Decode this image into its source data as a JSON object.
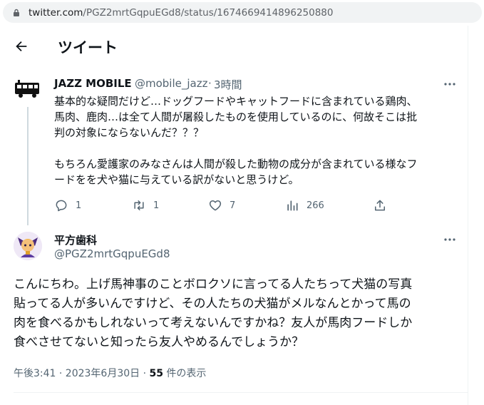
{
  "browser": {
    "url_domain": "twitter.com",
    "url_path": "/PGZ2mrtGqpuEGd8/status/1674669414896250880"
  },
  "header": {
    "title": "ツイート"
  },
  "parent_tweet": {
    "display_name": "JAZZ MOBILE",
    "handle": "@mobile_jazz",
    "separator": "·",
    "time": "3時間",
    "lines": [
      "基本的な疑問だけど…ドッグフードやキャットフードに含まれている鶏肉、",
      "馬肉、鹿肉…は全て人間が屠殺したものを使用しているのに、何故そこは批",
      "判の対象にならないんだ？？？",
      "",
      "もちろん愛護家のみなさんは人間が殺した動物の成分が含まれている様なフ",
      "ードをを犬や猫に与えている訳がないと思うけど。"
    ],
    "replies": "1",
    "retweets": "1",
    "likes": "7",
    "views": "266"
  },
  "main_tweet": {
    "display_name": "平方歯科",
    "handle": "@PGZ2mrtGqpuEGd8",
    "lines": [
      "こんにちわ。上げ馬神事のことボロクソに言ってる人たちって犬猫の写真",
      "貼ってる人が多いんですけど、その人たちの犬猫がメルなんとかって馬の",
      "肉を食べるかもしれないって考えないんですかね？友人が馬肉フードしか",
      "食べさせてないと知ったら友人やめるんでしょうか？"
    ],
    "timestamp": "午後3:41 · 2023年6月30日 · ",
    "views_count": "55",
    "views_label": " 件の表示"
  },
  "colors": {
    "text": "#0f1419",
    "secondary": "#536471",
    "border": "#eff3f4"
  }
}
